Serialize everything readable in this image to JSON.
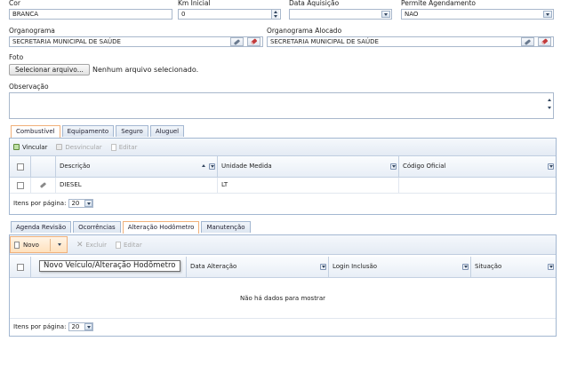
{
  "form": {
    "cor": {
      "label": "Cor",
      "value": "BRANCA"
    },
    "km_inicial": {
      "label": "Km Inicial",
      "value": "0"
    },
    "data_aquisicao": {
      "label": "Data Aquisição",
      "value": ""
    },
    "permite_agendamento": {
      "label": "Permite Agendamento",
      "value": "NAO"
    },
    "organograma": {
      "label": "Organograma",
      "value": "SECRETARIA MUNICIPAL DE SAÚDE"
    },
    "organograma_alocado": {
      "label": "Organograma Alocado",
      "value": "SECRETARIA MUNICIPAL DE SAÚDE"
    },
    "foto": {
      "label": "Foto",
      "button": "Selecionar arquivo...",
      "status": "Nenhum arquivo selecionado."
    },
    "observacao": {
      "label": "Observação",
      "value": ""
    }
  },
  "upper_tabs": [
    "Combustível",
    "Equipamento",
    "Seguro",
    "Aluguel"
  ],
  "upper_toolbar": {
    "vincular": "Vincular",
    "desvincular": "Desvincular",
    "editar": "Editar"
  },
  "upper_grid": {
    "columns": [
      "Descrição",
      "Unidade Medida",
      "Código Oficial"
    ],
    "rows": [
      {
        "descricao": "DIESEL",
        "unidade": "LT",
        "codigo": ""
      }
    ],
    "pager_label": "Itens por página:",
    "pager_value": "20"
  },
  "lower_tabs": [
    "Agenda Revisão",
    "Ocorrências",
    "Alteração Hodômetro",
    "Manutenção"
  ],
  "lower_toolbar": {
    "novo": "Novo",
    "excluir": "Excluir",
    "editar": "Editar"
  },
  "tooltip": "Novo Veículo/Alteração Hodômetro",
  "lower_grid": {
    "columns": [
      "Data Alteração",
      "Login Inclusão",
      "Situação"
    ],
    "empty_message": "Não há dados para mostrar",
    "pager_label": "Itens por página:",
    "pager_value": "20"
  }
}
